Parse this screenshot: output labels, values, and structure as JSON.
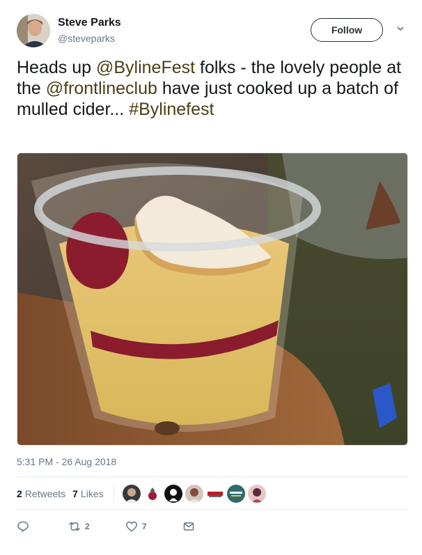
{
  "author": {
    "name": "Steve Parks",
    "handle": "@steveparks"
  },
  "follow_label": "Follow",
  "tweet": {
    "part1": "Heads up ",
    "mention1": "@BylineFest",
    "part2": " folks - the lovely people at the ",
    "mention2": "@frontlineclub",
    "part3": " have just cooked up a batch of mulled cider... ",
    "hashtag": "#Bylinefest"
  },
  "timestamp": "5:31 PM - 26 Aug 2018",
  "stats": {
    "retweets_count": "2",
    "retweets_label": "Retweets",
    "likes_count": "7",
    "likes_label": "Likes"
  },
  "actions": {
    "retweet_count": "2",
    "like_count": "7"
  },
  "colors": {
    "accent": "#4a3f14",
    "muted": "#657786",
    "text": "#14171a"
  },
  "icons": [
    "chevron-down-icon",
    "reply-icon",
    "retweet-icon",
    "heart-icon",
    "message-icon"
  ]
}
